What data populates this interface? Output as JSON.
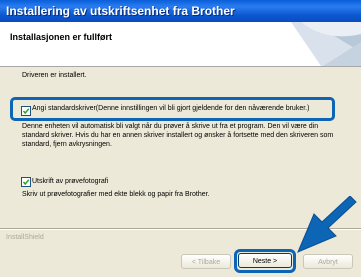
{
  "window": {
    "title": "Installering av utskriftsenhet fra Brother"
  },
  "header": {
    "title": "Installasjonen er fullført"
  },
  "body": {
    "driver_installed": "Driveren er installert.",
    "default_printer_label": "Angi standardskriver(Denne innstillingen vil bli gjort gjeldende for den nåværende bruker.)",
    "default_printer_checked": true,
    "default_printer_description": "Denne enheten vil automatisk bli valgt når du prøver å skrive ut fra et program. Den vil være din standard skriver. Hvis du har en annen skriver installert og ønsker å fortsette med den skriveren som standard, fjern avkrysningen.",
    "test_print_label": "Utskrift av prøvefotografi",
    "test_print_checked": true,
    "test_print_description": "Skriv ut prøvefotografier med ekte blekk og papir fra Brother."
  },
  "footer": {
    "installshield": "InstallShield",
    "back_label": "< Tilbake",
    "next_label": "Neste >",
    "cancel_label": "Avbryt"
  },
  "colors": {
    "highlight": "#0c65b5",
    "titlebar": "#0a5fd8"
  }
}
